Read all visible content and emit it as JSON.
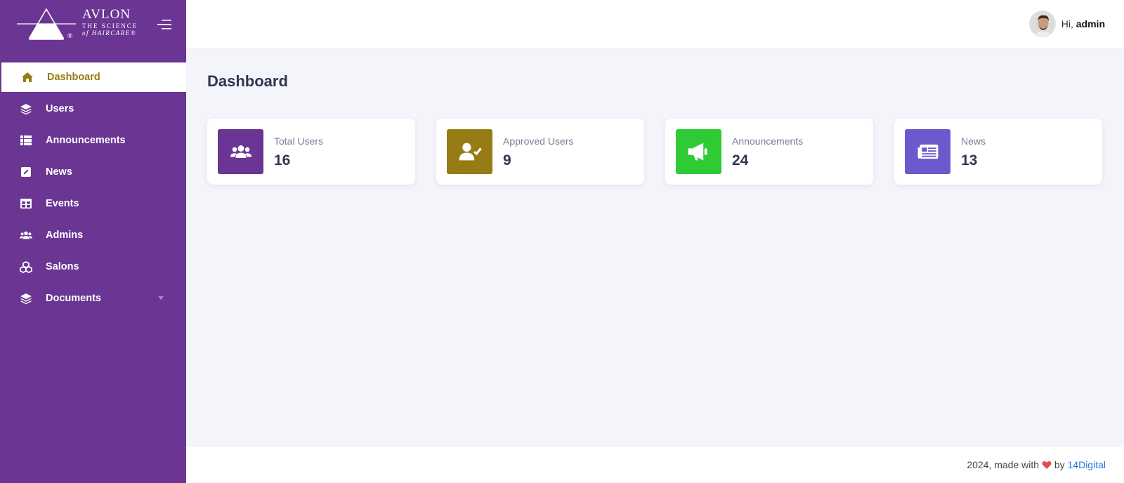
{
  "brand": {
    "name": "AVLON",
    "tagline_line1": "THE SCIENCE",
    "tagline_line2": "of HAIRCARE®",
    "mark": "®"
  },
  "sidebar": {
    "items": [
      {
        "label": "Dashboard",
        "icon": "home-icon",
        "active": true
      },
      {
        "label": "Users",
        "icon": "layers-icon"
      },
      {
        "label": "Announcements",
        "icon": "table-icon"
      },
      {
        "label": "News",
        "icon": "edit-icon"
      },
      {
        "label": "Events",
        "icon": "calendar-table-icon"
      },
      {
        "label": "Admins",
        "icon": "users-icon"
      },
      {
        "label": "Salons",
        "icon": "cubes-icon"
      },
      {
        "label": "Documents",
        "icon": "layers-icon",
        "has_submenu": true
      }
    ]
  },
  "header": {
    "greeting": "Hi,",
    "username": "admin"
  },
  "main": {
    "title": "Dashboard",
    "cards": [
      {
        "label": "Total Users",
        "value": "16",
        "color": "#6a3593",
        "icon": "users-icon"
      },
      {
        "label": "Approved Users",
        "value": "9",
        "color": "#957c15",
        "icon": "user-check-icon"
      },
      {
        "label": "Announcements",
        "value": "24",
        "color": "#2ecb35",
        "icon": "megaphone-icon"
      },
      {
        "label": "News",
        "value": "13",
        "color": "#6a5acd",
        "icon": "newspaper-icon"
      }
    ]
  },
  "footer": {
    "prefix": "2024, made with",
    "by": "by",
    "link_text": "14Digital"
  },
  "colors": {
    "sidebar_bg": "#6a3593",
    "active_text": "#957c15",
    "page_bg": "#f4f5fa",
    "heart": "#e24c4c"
  }
}
